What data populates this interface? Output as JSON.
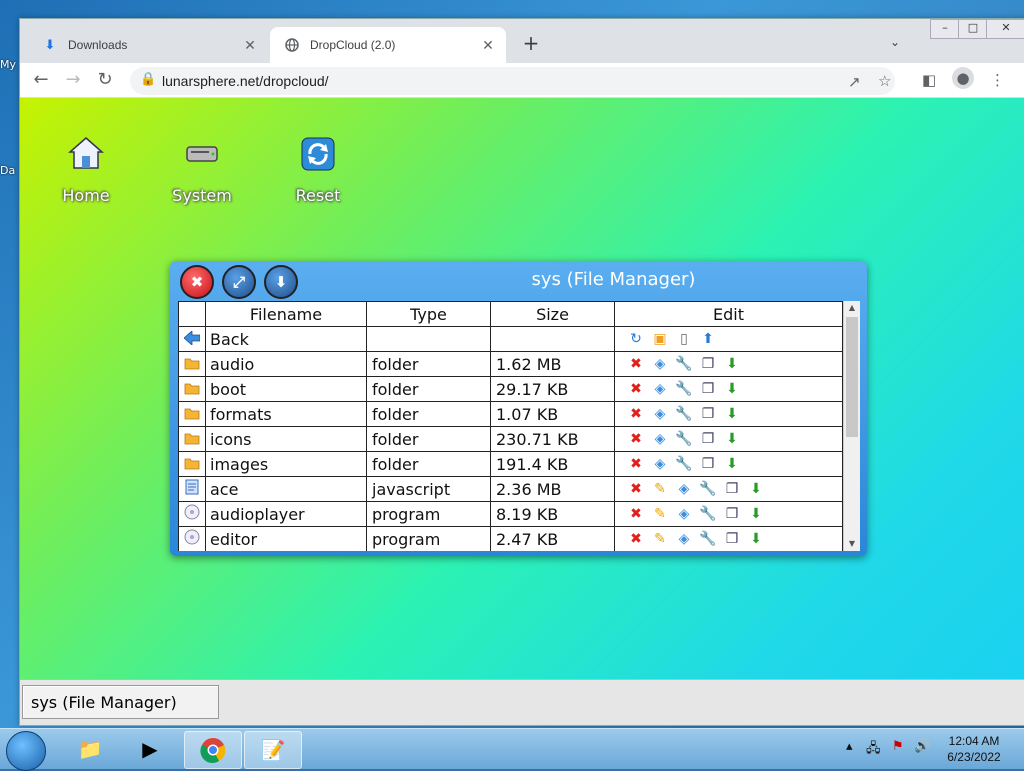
{
  "desktop_labels": [
    "My",
    "Da"
  ],
  "browser": {
    "tabs": [
      {
        "label": "Downloads",
        "icon": "download-icon",
        "active": false
      },
      {
        "label": "DropCloud (2.0)",
        "icon": "globe-icon",
        "active": true
      }
    ],
    "url": "lunarsphere.net/dropcloud/"
  },
  "page": {
    "desktop_icons": [
      {
        "label": "Home",
        "icon": "home-icon"
      },
      {
        "label": "System",
        "icon": "drive-icon"
      },
      {
        "label": "Reset",
        "icon": "refresh-icon"
      }
    ],
    "file_manager": {
      "title": "sys (File Manager)",
      "columns": [
        "Filename",
        "Type",
        "Size",
        "Edit"
      ],
      "rows": [
        {
          "icon": "back-arrow-icon",
          "name": "Back",
          "type": "",
          "size": "",
          "actions": [
            "refresh",
            "new-folder",
            "new-file",
            "upload"
          ]
        },
        {
          "icon": "folder-icon",
          "name": "audio",
          "type": "folder",
          "size": "1.62 MB",
          "actions": [
            "delete",
            "rename",
            "properties",
            "copy",
            "download"
          ]
        },
        {
          "icon": "folder-icon",
          "name": "boot",
          "type": "folder",
          "size": "29.17 KB",
          "actions": [
            "delete",
            "rename",
            "properties",
            "copy",
            "download"
          ]
        },
        {
          "icon": "folder-icon",
          "name": "formats",
          "type": "folder",
          "size": "1.07 KB",
          "actions": [
            "delete",
            "rename",
            "properties",
            "copy",
            "download"
          ]
        },
        {
          "icon": "folder-icon",
          "name": "icons",
          "type": "folder",
          "size": "230.71 KB",
          "actions": [
            "delete",
            "rename",
            "properties",
            "copy",
            "download"
          ]
        },
        {
          "icon": "folder-icon",
          "name": "images",
          "type": "folder",
          "size": "191.4 KB",
          "actions": [
            "delete",
            "rename",
            "properties",
            "copy",
            "download"
          ]
        },
        {
          "icon": "script-icon",
          "name": "ace",
          "type": "javascript",
          "size": "2.36 MB",
          "actions": [
            "delete",
            "edit",
            "rename",
            "properties",
            "copy",
            "download"
          ]
        },
        {
          "icon": "program-icon",
          "name": "audioplayer",
          "type": "program",
          "size": "8.19 KB",
          "actions": [
            "delete",
            "edit",
            "rename",
            "properties",
            "copy",
            "download"
          ]
        },
        {
          "icon": "program-icon",
          "name": "editor",
          "type": "program",
          "size": "2.47 KB",
          "actions": [
            "delete",
            "edit",
            "rename",
            "properties",
            "copy",
            "download"
          ]
        }
      ]
    },
    "taskbar_item": "sys (File Manager)"
  },
  "os_taskbar": {
    "time": "12:04 AM",
    "date": "6/23/2022"
  },
  "colors": {
    "accent_blue": "#2a86d8",
    "delete_red": "#e0201c",
    "folder_orange": "#f0a020"
  }
}
